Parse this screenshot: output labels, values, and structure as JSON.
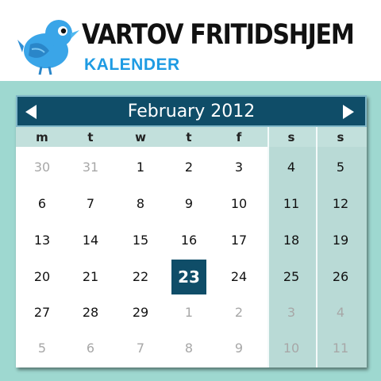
{
  "header": {
    "title": "VARTOV FRITIDSHJEM",
    "subtitle": "KALENDER",
    "logo_icon": "bird-logo-icon"
  },
  "calendar": {
    "month_label": "February 2012",
    "prev_icon": "triangle-left-icon",
    "next_icon": "triangle-right-icon",
    "weekdays": [
      "m",
      "t",
      "w",
      "t",
      "f",
      "s",
      "s"
    ],
    "weeks": [
      [
        {
          "d": "30",
          "o": true
        },
        {
          "d": "31",
          "o": true
        },
        {
          "d": "1"
        },
        {
          "d": "2"
        },
        {
          "d": "3"
        },
        {
          "d": "4"
        },
        {
          "d": "5"
        }
      ],
      [
        {
          "d": "6"
        },
        {
          "d": "7"
        },
        {
          "d": "8"
        },
        {
          "d": "9"
        },
        {
          "d": "10"
        },
        {
          "d": "11"
        },
        {
          "d": "12"
        }
      ],
      [
        {
          "d": "13"
        },
        {
          "d": "14"
        },
        {
          "d": "15"
        },
        {
          "d": "16"
        },
        {
          "d": "17"
        },
        {
          "d": "18"
        },
        {
          "d": "19"
        }
      ],
      [
        {
          "d": "20"
        },
        {
          "d": "21"
        },
        {
          "d": "22"
        },
        {
          "d": "23",
          "sel": true
        },
        {
          "d": "24"
        },
        {
          "d": "25"
        },
        {
          "d": "26"
        }
      ],
      [
        {
          "d": "27"
        },
        {
          "d": "28"
        },
        {
          "d": "29"
        },
        {
          "d": "1",
          "o": true
        },
        {
          "d": "2",
          "o": true
        },
        {
          "d": "3",
          "o": true
        },
        {
          "d": "4",
          "o": true
        }
      ],
      [
        {
          "d": "5",
          "o": true
        },
        {
          "d": "6",
          "o": true
        },
        {
          "d": "7",
          "o": true
        },
        {
          "d": "8",
          "o": true
        },
        {
          "d": "9",
          "o": true
        },
        {
          "d": "10",
          "o": true
        },
        {
          "d": "11",
          "o": true
        }
      ]
    ]
  },
  "colors": {
    "header_blue": "#0f4d68",
    "selected_bg": "#0f4d68",
    "backdrop": "#9ed8d0",
    "weekend_bg": "#b9dad6",
    "subtitle_blue": "#1e9be3"
  }
}
